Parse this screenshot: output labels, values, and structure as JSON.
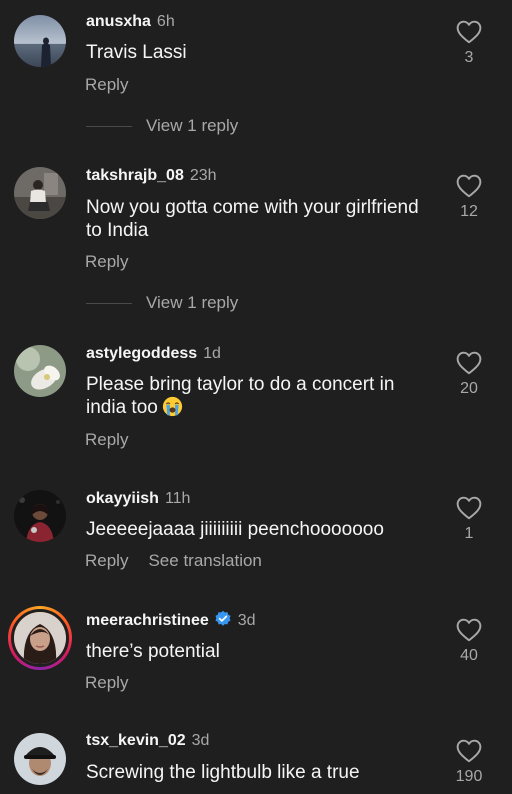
{
  "comments": [
    {
      "username": "anusxha",
      "time": "6h",
      "text": "Travis Lassi",
      "reply_label": "Reply",
      "view_replies": "View 1 reply",
      "likes": "3",
      "avatar": "beach-silhouette-photo"
    },
    {
      "username": "takshrajb_08",
      "time": "23h",
      "text": "Now you gotta come with your girlfriend to India",
      "reply_label": "Reply",
      "view_replies": "View 1 reply",
      "likes": "12",
      "avatar": "person-sitting-photo"
    },
    {
      "username": "astylegoddess",
      "time": "1d",
      "text": "Please bring taylor to do a concert in india too",
      "emoji": "loudly-crying-face",
      "reply_label": "Reply",
      "likes": "20",
      "avatar": "flower-photo"
    },
    {
      "username": "okayyiish",
      "time": "11h",
      "text": "Jeeeeejaaaa jiiiiiiiii peenchooooooo",
      "reply_label": "Reply",
      "translation_label": "See translation",
      "likes": "1",
      "avatar": "dark-portrait-photo"
    },
    {
      "username": "meerachristinee",
      "verified": true,
      "time": "3d",
      "text": "there’s potential",
      "reply_label": "Reply",
      "likes": "40",
      "avatar": "woman-portrait-photo",
      "story_ring": true
    },
    {
      "username": "tsx_kevin_02",
      "time": "3d",
      "text": "Screwing the lightbulb like a true",
      "likes": "190",
      "avatar": "man-cap-photo"
    }
  ],
  "colors": {
    "background": "#1f1f1f",
    "primary_text": "#f5f5f5",
    "secondary_text": "#a8a8a8",
    "verified_badge": "#3797f0"
  }
}
